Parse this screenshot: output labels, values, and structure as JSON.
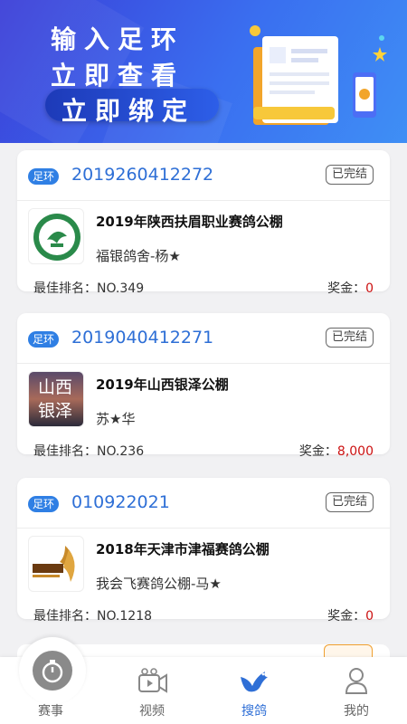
{
  "banner": {
    "line1": "输入足环",
    "line2": "立即查看",
    "line3": "立即绑定"
  },
  "cards": [
    {
      "tag": "足环",
      "ring_no": "2019260412272",
      "status": "已完结",
      "logo_icon": "pigeon-club-circle-logo",
      "race_name": "2019年陕西扶眉职业赛鸽公棚",
      "owner": "福银鸽舍-杨★",
      "rank_label": "最佳排名：",
      "rank_value": "NO.349",
      "prize_label": "奖金：",
      "prize_value": "0"
    },
    {
      "tag": "足环",
      "ring_no": "2019040412271",
      "status": "已完结",
      "logo_icon": "shanxi-yinze-logo",
      "logo_text_1": "山西",
      "logo_text_2": "银泽",
      "race_name": "2019年山西银泽公棚",
      "owner": "苏★华",
      "rank_label": "最佳排名：",
      "rank_value": "NO.236",
      "prize_label": "奖金：",
      "prize_value": "8,000"
    },
    {
      "tag": "足环",
      "ring_no": "010922021",
      "status": "已完结",
      "logo_icon": "jinfu-logo",
      "race_name": "2018年天津市津福赛鸽公棚",
      "owner": "我会飞赛鸽公棚-马★",
      "rank_label": "最佳排名：",
      "rank_value": "NO.1218",
      "prize_label": "奖金：",
      "prize_value": "0"
    }
  ],
  "tabs": [
    {
      "label": "赛事",
      "icon": "timer-icon"
    },
    {
      "label": "视频",
      "icon": "video-icon"
    },
    {
      "label": "搜鸽",
      "icon": "bird-icon",
      "active": true
    },
    {
      "label": "我的",
      "icon": "user-icon"
    }
  ],
  "colors": {
    "accent": "#2f6fd6",
    "prize_red": "#cc1111",
    "banner_start": "#3b3fd8",
    "banner_end": "#3f8ff5"
  }
}
